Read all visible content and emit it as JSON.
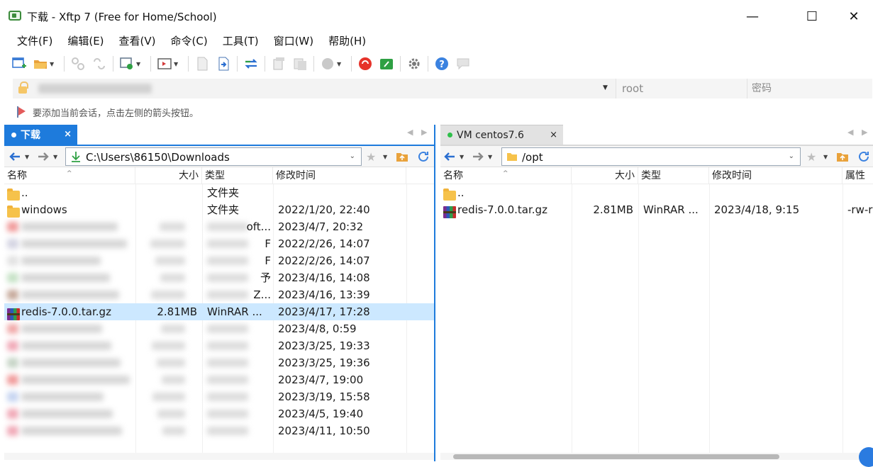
{
  "window": {
    "title": "下载 - Xftp 7 (Free for Home/School)",
    "controls": {
      "minimize": "—",
      "maximize": "☐",
      "close": "✕"
    }
  },
  "menu": [
    {
      "label": "文件(F)"
    },
    {
      "label": "编辑(E)"
    },
    {
      "label": "查看(V)"
    },
    {
      "label": "命令(C)"
    },
    {
      "label": "工具(T)"
    },
    {
      "label": "窗口(W)"
    },
    {
      "label": "帮助(H)"
    }
  ],
  "connect_bar": {
    "user_placeholder": "root",
    "password_placeholder": "密码"
  },
  "hint": {
    "text": "要添加当前会话，点击左侧的箭头按钮。"
  },
  "left_pane": {
    "tab_label": "下载",
    "tab_close": "×",
    "path": "C:\\Users\\86150\\Downloads",
    "columns": {
      "name": "名称",
      "size": "大小",
      "type": "类型",
      "modified": "修改时间"
    },
    "rows": [
      {
        "name": "..",
        "size": "",
        "type": "文件夹",
        "modified": "",
        "icon": "folder"
      },
      {
        "name": "windows",
        "size": "",
        "type": "文件夹",
        "modified": "2022/1/20, 22:40",
        "icon": "folder"
      },
      {
        "name": "",
        "size": "",
        "type": "oft...",
        "modified": "2023/4/7, 20:32",
        "icon": "blurred"
      },
      {
        "name": "",
        "size": "",
        "type": "F",
        "modified": "2022/2/26, 14:07",
        "icon": "blurred"
      },
      {
        "name": "",
        "size": "",
        "type": "F",
        "modified": "2022/2/26, 14:07",
        "icon": "blurred"
      },
      {
        "name": "",
        "size": "",
        "type": "予",
        "modified": "2023/4/16, 14:08",
        "icon": "blurred"
      },
      {
        "name": "",
        "size": "",
        "type": "Z...",
        "modified": "2023/4/16, 13:39",
        "icon": "blurred"
      },
      {
        "name": "redis-7.0.0.tar.gz",
        "size": "2.81MB",
        "type": "WinRAR ...",
        "modified": "2023/4/17, 17:28",
        "icon": "rar",
        "selected": true
      },
      {
        "name": "",
        "size": "",
        "type": "",
        "modified": "2023/4/8, 0:59",
        "icon": "blurred"
      },
      {
        "name": "",
        "size": "",
        "type": "",
        "modified": "2023/3/25, 19:33",
        "icon": "blurred"
      },
      {
        "name": "",
        "size": "",
        "type": "",
        "modified": "2023/3/25, 19:36",
        "icon": "blurred"
      },
      {
        "name": "",
        "size": "",
        "type": "",
        "modified": "2023/4/7, 19:00",
        "icon": "blurred"
      },
      {
        "name": "",
        "size": "",
        "type": "",
        "modified": "2023/3/19, 15:58",
        "icon": "blurred"
      },
      {
        "name": "",
        "size": "",
        "type": "",
        "modified": "2023/4/5, 19:40",
        "icon": "blurred"
      },
      {
        "name": "",
        "size": "",
        "type": "",
        "modified": "2023/4/11, 10:50",
        "icon": "blurred"
      }
    ]
  },
  "right_pane": {
    "tab_label": "VM centos7.6",
    "tab_close": "×",
    "status_color": "#2fbf4a",
    "path": "/opt",
    "columns": {
      "name": "名称",
      "size": "大小",
      "type": "类型",
      "modified": "修改时间",
      "attrs": "属性"
    },
    "rows": [
      {
        "name": "..",
        "size": "",
        "type": "",
        "modified": "",
        "attrs": "",
        "icon": "folder"
      },
      {
        "name": "redis-7.0.0.tar.gz",
        "size": "2.81MB",
        "type": "WinRAR ...",
        "modified": "2023/4/18, 9:15",
        "attrs": "-rw-r",
        "icon": "rar"
      }
    ]
  }
}
